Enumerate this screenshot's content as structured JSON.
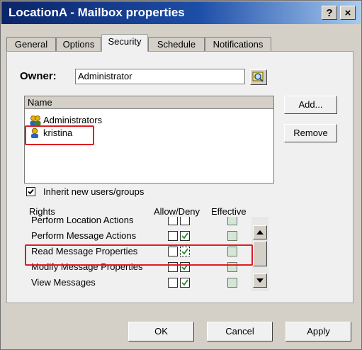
{
  "window": {
    "title": "LocationA - Mailbox properties",
    "help_label": "?",
    "close_label": "×"
  },
  "tabs": [
    {
      "label": "General",
      "active": false
    },
    {
      "label": "Options",
      "active": false
    },
    {
      "label": "Security",
      "active": true
    },
    {
      "label": "Schedule",
      "active": false
    },
    {
      "label": "Notifications",
      "active": false
    }
  ],
  "owner": {
    "label": "Owner:",
    "value": "Administrator",
    "browse_icon": "search-icon"
  },
  "names": {
    "header": "Name",
    "items": [
      {
        "label": "Administrators",
        "icon": "group-icon"
      },
      {
        "label": "kristina",
        "icon": "user-icon",
        "highlighted": true
      }
    ]
  },
  "buttons": {
    "add": "Add...",
    "remove": "Remove",
    "ok": "OK",
    "cancel": "Cancel",
    "apply": "Apply"
  },
  "inherit": {
    "label": "Inherit new users/groups",
    "checked": true
  },
  "rights": {
    "headers": {
      "rights": "Rights",
      "allow_deny": "Allow/Deny",
      "effective": "Effective"
    },
    "rows": [
      {
        "name": "Perform Location Actions",
        "allow": false,
        "deny": false,
        "effective": true
      },
      {
        "name": "Perform Message Actions",
        "allow": false,
        "deny": true,
        "effective": true
      },
      {
        "name": "Read Message Properties",
        "allow": false,
        "deny": true,
        "effective": true,
        "highlighted": true
      },
      {
        "name": "Modify Message Properties",
        "allow": false,
        "deny": true,
        "effective": true
      },
      {
        "name": "View Messages",
        "allow": false,
        "deny": true,
        "effective": true
      }
    ]
  },
  "colors": {
    "titlebar_start": "#0a246a",
    "highlight_red": "#e01b24",
    "check_green": "#1a8c1a"
  }
}
